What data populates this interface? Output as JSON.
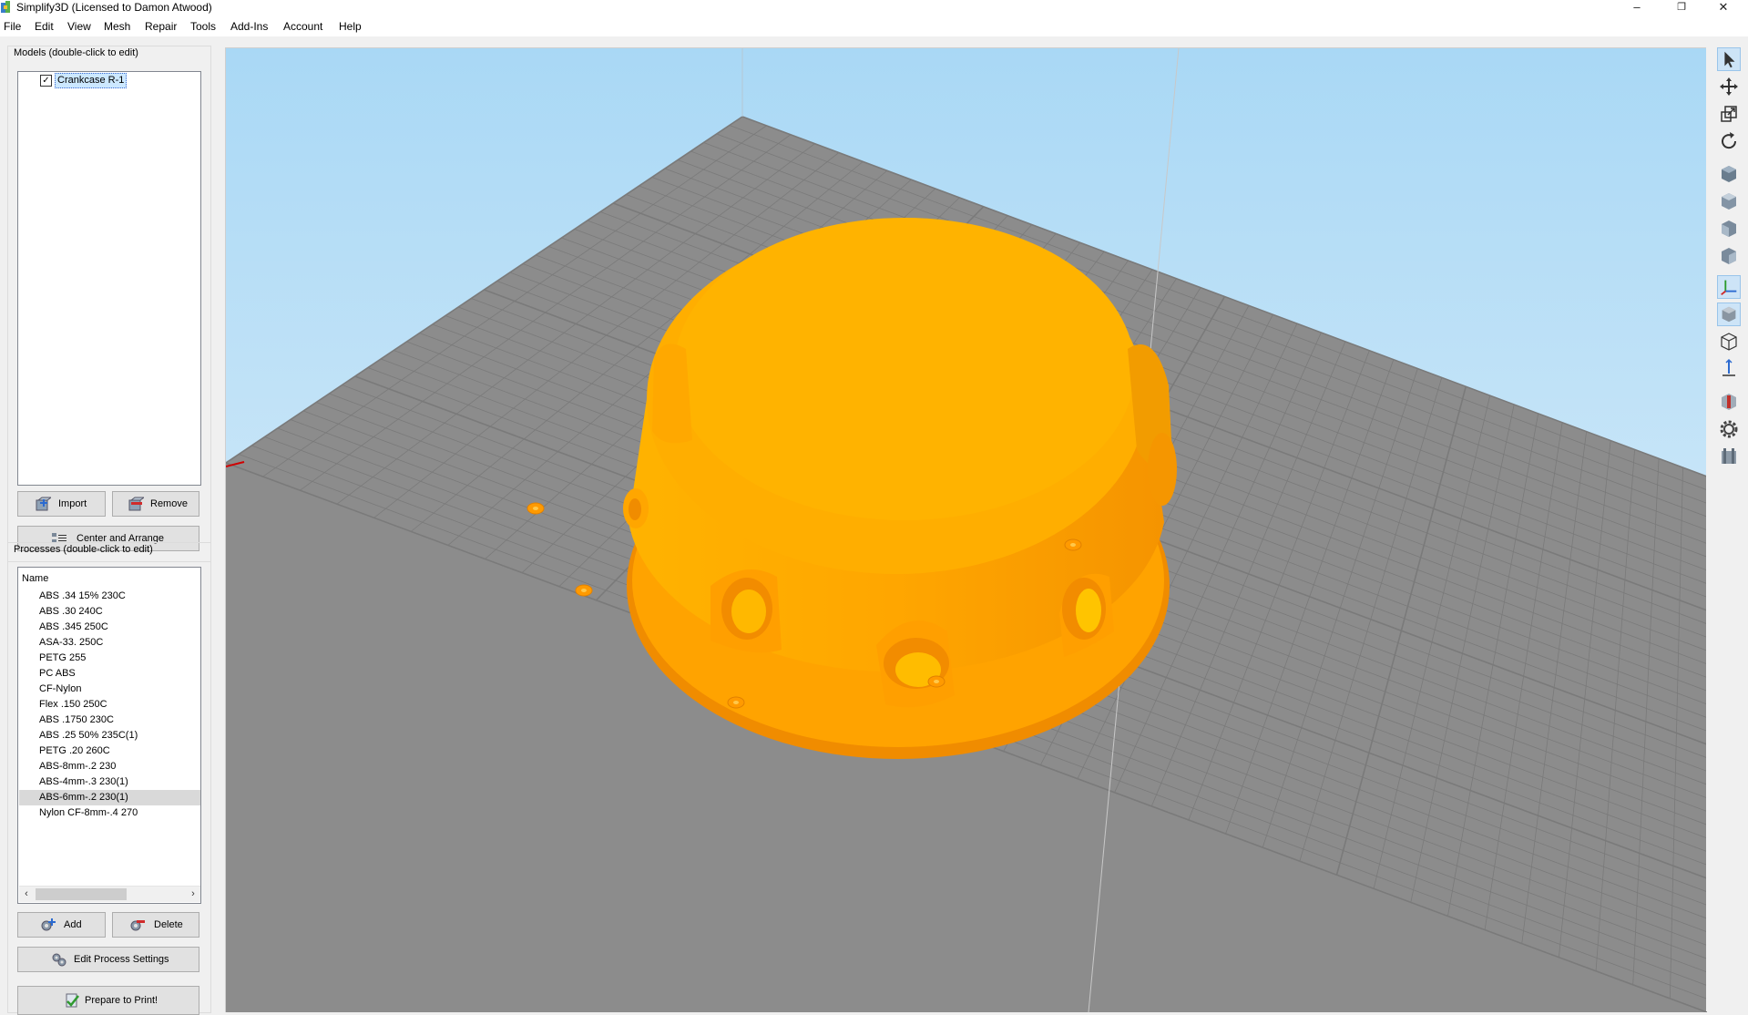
{
  "window": {
    "title": "Simplify3D (Licensed to Damon Atwood)",
    "minimize": "–",
    "restore": "❐",
    "close": "✕"
  },
  "menu": [
    "File",
    "Edit",
    "View",
    "Mesh",
    "Repair",
    "Tools",
    "Add-Ins",
    "Account",
    "Help"
  ],
  "models": {
    "label": "Models (double-click to edit)",
    "items": [
      {
        "name": "Crankcase R-1",
        "checked": true
      }
    ],
    "import_label": "Import",
    "remove_label": "Remove",
    "center_label": "Center and Arrange"
  },
  "processes": {
    "label": "Processes (double-click to edit)",
    "column": "Name",
    "items": [
      "ABS .34 15% 230C",
      "ABS .30 240C",
      "ABS .345 250C",
      "ASA-33. 250C",
      "PETG 255",
      "PC ABS",
      "CF-Nylon",
      "Flex .150 250C",
      "ABS .1750 230C",
      "ABS .25 50% 235C(1)",
      "PETG .20 260C",
      "ABS-8mm-.2 230",
      "ABS-4mm-.3 230(1)",
      "ABS-6mm-.2 230(1)",
      "Nylon CF-8mm-.4 270"
    ],
    "selected_index": 13,
    "add_label": "Add",
    "delete_label": "Delete",
    "edit_label": "Edit Process Settings",
    "prepare_label": "Prepare to Print!"
  },
  "colors": {
    "model": "#ffad00",
    "bed": "#8c8c8c",
    "sky_top": "#a9d8f5",
    "sky_bottom": "#eaf4fb"
  },
  "toolbar_icons": [
    "select-icon",
    "move-icon",
    "scale-icon",
    "rotate-icon",
    "view-default-icon",
    "view-top-icon",
    "view-front-icon",
    "view-side-icon",
    "axes-toggle-icon",
    "solid-mode-icon",
    "wireframe-mode-icon",
    "build-volume-icon",
    "cross-section-icon",
    "settings-gear-icon",
    "machine-control-icon"
  ]
}
